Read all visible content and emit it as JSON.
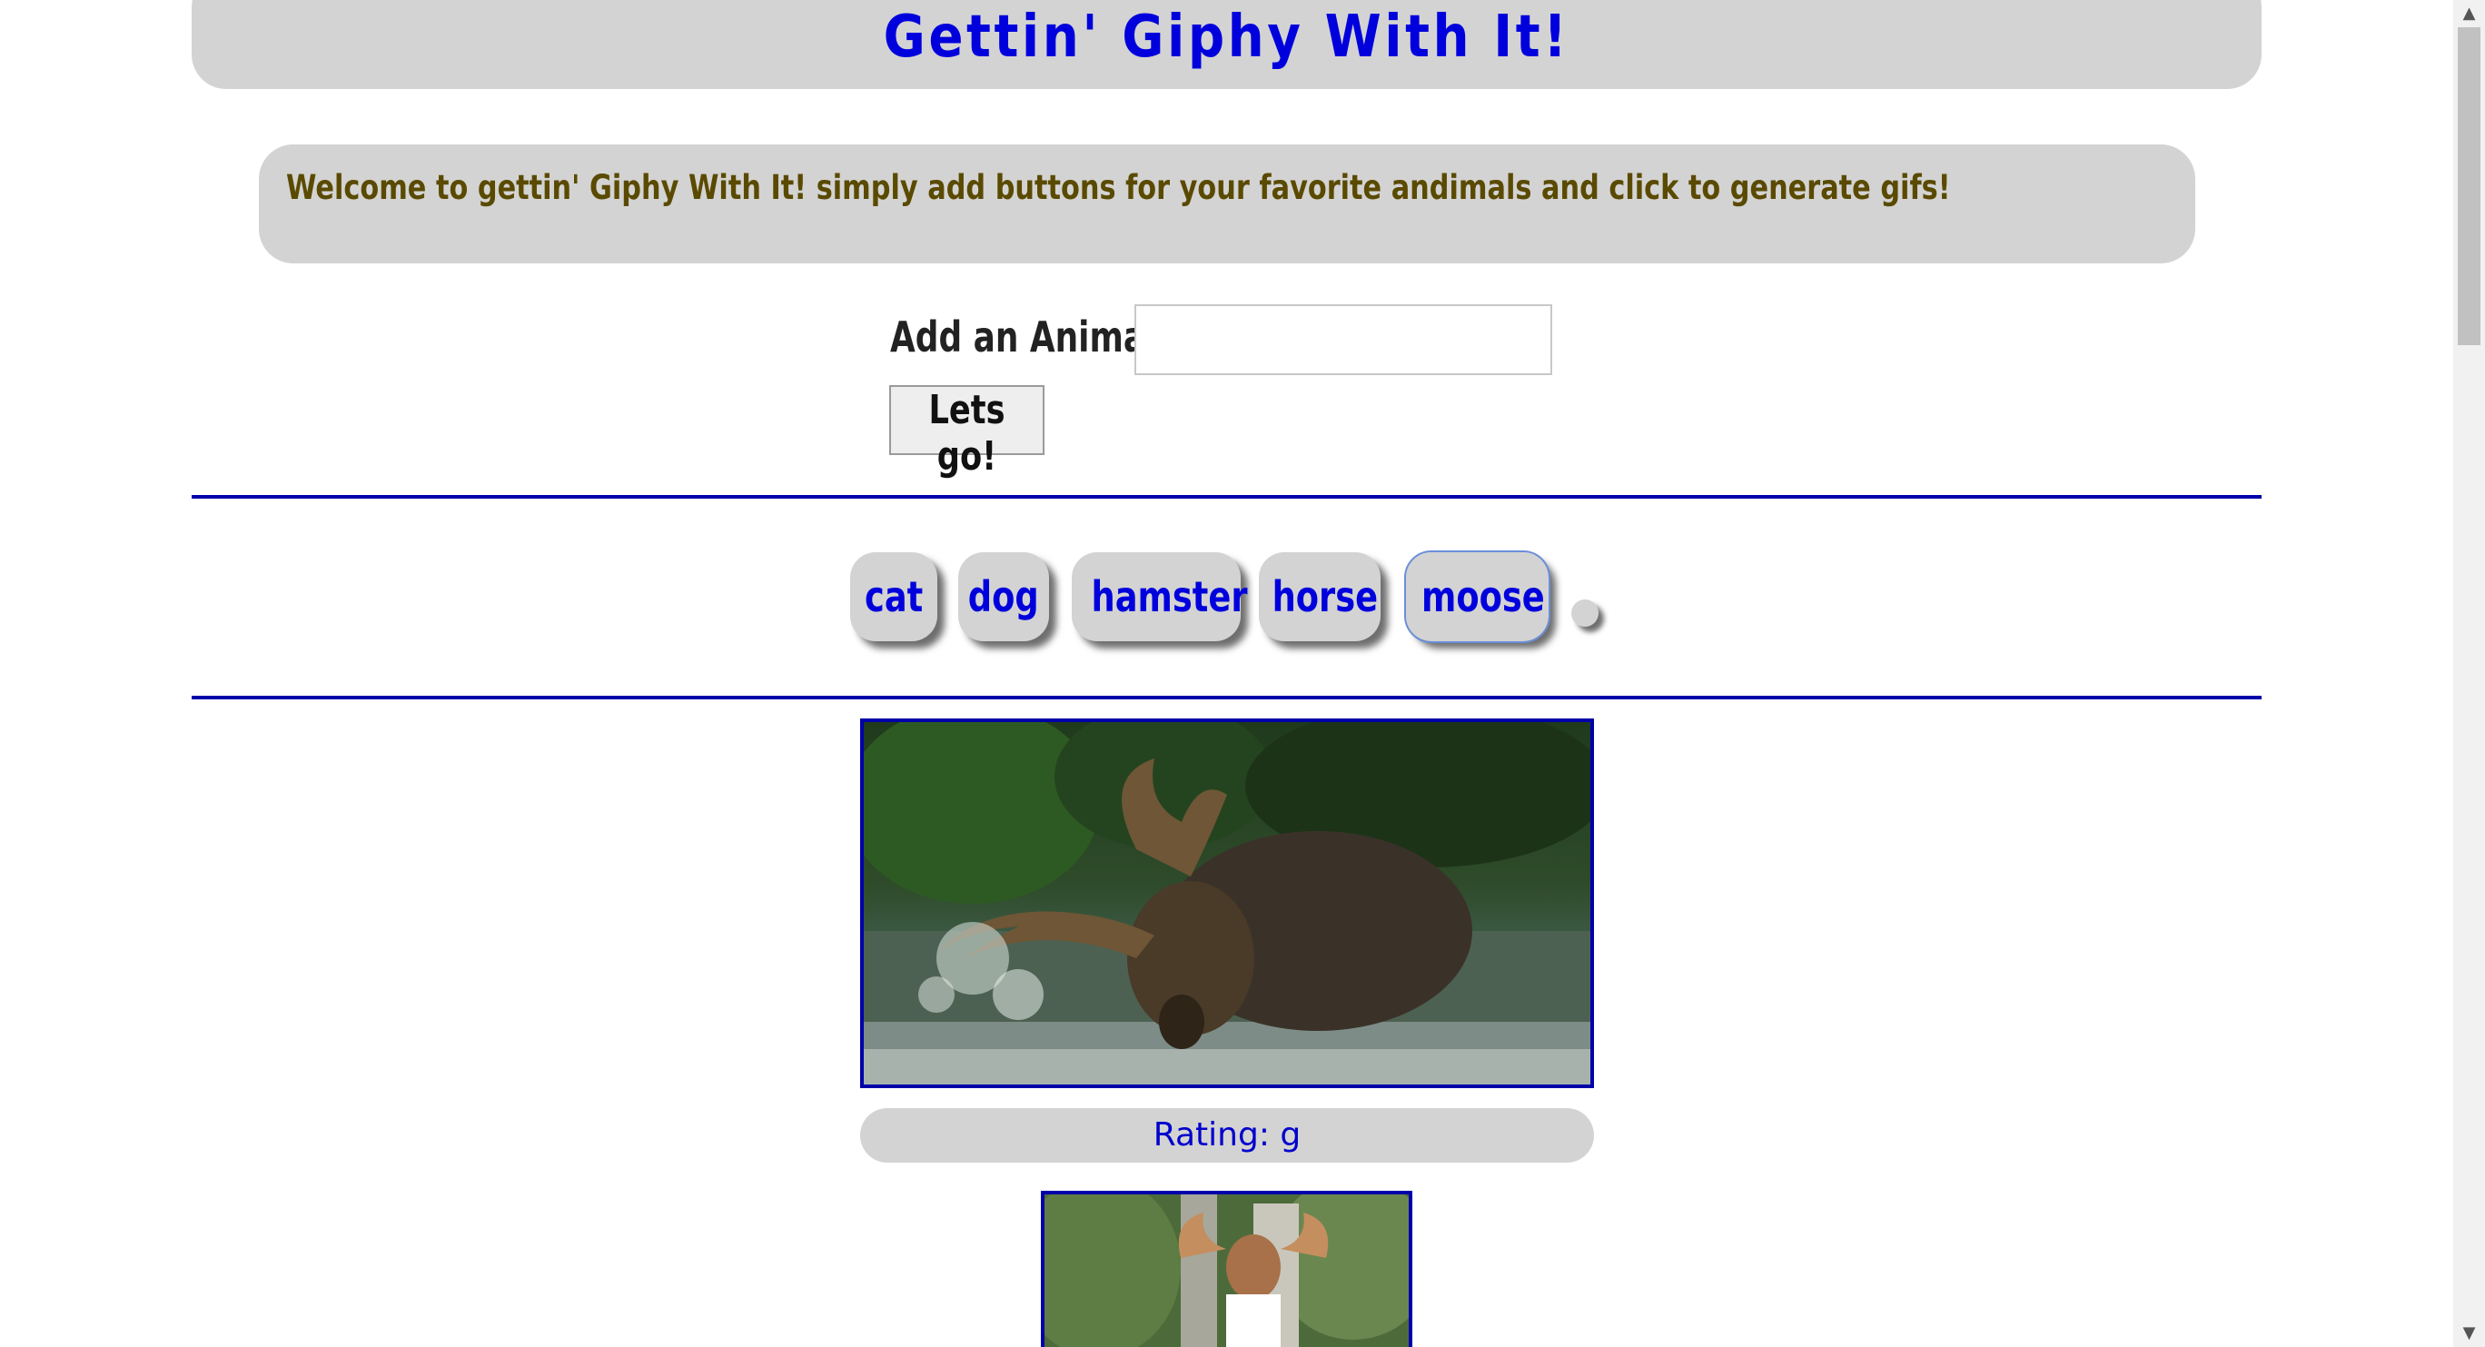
{
  "header": {
    "title": "Gettin' Giphy With It!"
  },
  "welcome": {
    "text": "Welcome to gettin' Giphy With It! simply add buttons for your favorite andimals and click to generate gifs!"
  },
  "form": {
    "label": "Add an Animal!",
    "input_value": "",
    "submit_label": "Lets go!"
  },
  "animal_buttons": [
    {
      "label": "cat"
    },
    {
      "label": "dog"
    },
    {
      "label": "hamster"
    },
    {
      "label": "horse"
    },
    {
      "label": "moose",
      "selected": true
    }
  ],
  "gifs": [
    {
      "subject": "moose splashing in water",
      "rating": "Rating: g"
    },
    {
      "subject": "moose mascot costume"
    }
  ],
  "colors": {
    "accent": "#0000dd",
    "panel": "#d3d3d3",
    "welcome_text": "#5a4a00",
    "divider": "#0000aa"
  },
  "icons": {
    "scroll_up": "triangle-up-icon",
    "scroll_down": "triangle-down-icon"
  }
}
